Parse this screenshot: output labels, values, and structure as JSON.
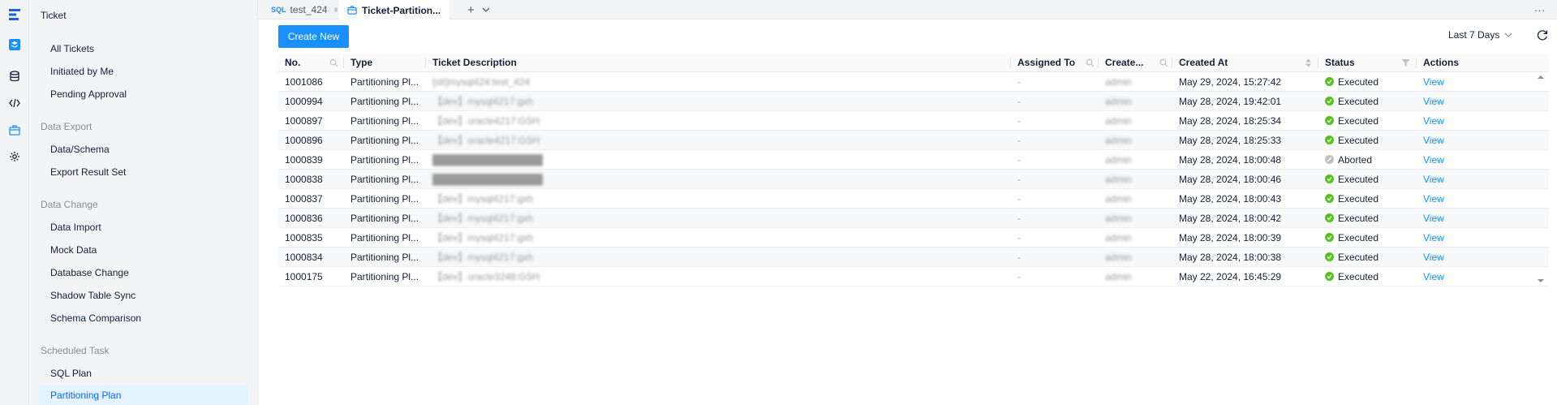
{
  "sidebar": {
    "title": "Ticket",
    "groups": [
      "Data Export",
      "Data Change",
      "Scheduled Task"
    ],
    "items": [
      "All Tickets",
      "Initiated by Me",
      "Pending Approval",
      "Data/Schema",
      "Export Result Set",
      "Data Import",
      "Mock Data",
      "Database Change",
      "Shadow Table Sync",
      "Schema Comparison",
      "SQL Plan",
      "Partitioning Plan"
    ],
    "active_item": "Partitioning Plan"
  },
  "tabs": [
    {
      "badge": "SQL",
      "label": "test_424"
    },
    {
      "label": "Ticket-Partition..."
    }
  ],
  "toolbar": {
    "create_label": "Create New",
    "time_range": "Last 7 Days",
    "more_label": "..."
  },
  "table": {
    "columns": [
      "No.",
      "Type",
      "Ticket Description",
      "Assigned To",
      "Create...",
      "Created At",
      "Status",
      "Actions"
    ],
    "rows": [
      {
        "no": "1001086",
        "type": "Partitioning Pl...",
        "desc": "[stt]mysql424:test_424",
        "assigned": "-",
        "creator": "admin",
        "created_at": "May 29, 2024, 15:27:42",
        "status": "Executed",
        "action": "View"
      },
      {
        "no": "1000994",
        "type": "Partitioning Pl...",
        "desc": "【dev】mysql4217:gxh",
        "assigned": "-",
        "creator": "admin",
        "created_at": "May 28, 2024, 19:42:01",
        "status": "Executed",
        "action": "View"
      },
      {
        "no": "1000897",
        "type": "Partitioning Pl...",
        "desc": "【dev】oracle4217:GSH",
        "assigned": "-",
        "creator": "admin",
        "created_at": "May 28, 2024, 18:25:34",
        "status": "Executed",
        "action": "View"
      },
      {
        "no": "1000896",
        "type": "Partitioning Pl...",
        "desc": "【dev】oracle4217:GSH",
        "assigned": "-",
        "creator": "admin",
        "created_at": "May 28, 2024, 18:25:33",
        "status": "Executed",
        "action": "View"
      },
      {
        "no": "1000839",
        "type": "Partitioning Pl...",
        "desc": "████████████████",
        "assigned": "-",
        "creator": "admin",
        "created_at": "May 28, 2024, 18:00:48",
        "status": "Aborted",
        "action": "View"
      },
      {
        "no": "1000838",
        "type": "Partitioning Pl...",
        "desc": "████████████████",
        "assigned": "-",
        "creator": "admin",
        "created_at": "May 28, 2024, 18:00:46",
        "status": "Executed",
        "action": "View"
      },
      {
        "no": "1000837",
        "type": "Partitioning Pl...",
        "desc": "【dev】mysql4217:gxh",
        "assigned": "-",
        "creator": "admin",
        "created_at": "May 28, 2024, 18:00:43",
        "status": "Executed",
        "action": "View"
      },
      {
        "no": "1000836",
        "type": "Partitioning Pl...",
        "desc": "【dev】mysql4217:gxh",
        "assigned": "-",
        "creator": "admin",
        "created_at": "May 28, 2024, 18:00:42",
        "status": "Executed",
        "action": "View"
      },
      {
        "no": "1000835",
        "type": "Partitioning Pl...",
        "desc": "【dev】mysql4217:gxh",
        "assigned": "-",
        "creator": "admin",
        "created_at": "May 28, 2024, 18:00:39",
        "status": "Executed",
        "action": "View"
      },
      {
        "no": "1000834",
        "type": "Partitioning Pl...",
        "desc": "【dev】mysql4217:gxh",
        "assigned": "-",
        "creator": "admin",
        "created_at": "May 28, 2024, 18:00:38",
        "status": "Executed",
        "action": "View"
      },
      {
        "no": "1000175",
        "type": "Partitioning Pl...",
        "desc": "【dev】oracle3248:GSH",
        "assigned": "-",
        "creator": "admin",
        "created_at": "May 22, 2024, 16:45:29",
        "status": "Executed",
        "action": "View"
      }
    ]
  },
  "colors": {
    "accent": "#1890ff",
    "active_item_bg": "#e5f2ff",
    "executed": "#52c41a",
    "aborted": "#bfbfbf"
  },
  "icons": {
    "activity_bar": [
      "logo-icon",
      "ticket-icon",
      "database-icon",
      "code-icon",
      "briefcase-icon",
      "settings-icon"
    ]
  }
}
